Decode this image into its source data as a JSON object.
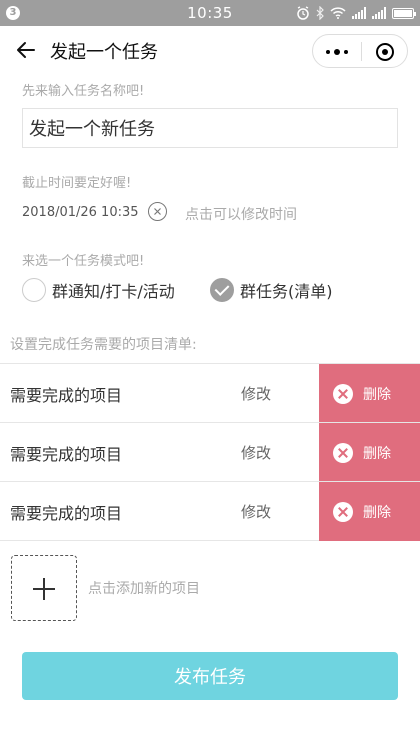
{
  "status_bar": {
    "notification_count": "3",
    "time": "10:35"
  },
  "nav": {
    "title": "发起一个任务"
  },
  "form": {
    "name_hint": "先来输入任务名称吧!",
    "name_value": "发起一个新任务",
    "deadline_hint": "截止时间要定好喔!",
    "deadline_value": "2018/01/26 10:35",
    "modify_time_text": "点击可以修改时间",
    "mode_hint": "来选一个任务模式吧!",
    "modes": [
      {
        "label": "群通知/打卡/活动",
        "checked": false
      },
      {
        "label": "群任务(清单)",
        "checked": true
      }
    ],
    "list_title": "设置完成任务需要的项目清单:",
    "items": [
      {
        "label": "需要完成的项目",
        "edit": "修改",
        "delete": "删除"
      },
      {
        "label": "需要完成的项目",
        "edit": "修改",
        "delete": "删除"
      },
      {
        "label": "需要完成的项目",
        "edit": "修改",
        "delete": "删除"
      }
    ],
    "add_item_text": "点击添加新的项目",
    "publish_label": "发布任务"
  },
  "colors": {
    "status_bar": "#9e9e9e",
    "delete_bg": "#e06d7e",
    "publish_bg": "#6fd4e0"
  }
}
